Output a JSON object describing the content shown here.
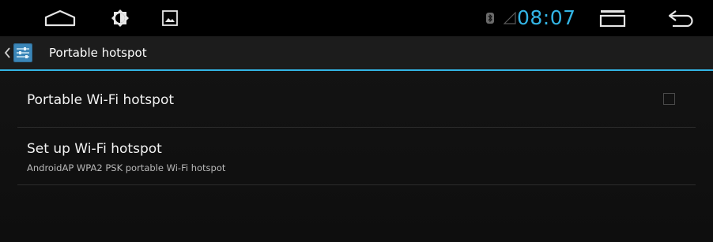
{
  "statusbar": {
    "home_icon": "home-icon",
    "brightness_icon": "brightness-icon",
    "gallery_icon": "gallery-icon",
    "bluetooth_icon": "bluetooth-icon",
    "signal_icon": "signal-icon",
    "time": "08:07",
    "recent_apps_icon": "recent-apps-icon",
    "back_icon": "back-icon",
    "accent_color": "#33b5e5"
  },
  "actionbar": {
    "up_icon": "chevron-left-icon",
    "app_icon": "settings-sliders-icon",
    "title": "Portable hotspot"
  },
  "list": {
    "items": [
      {
        "title": "Portable Wi-Fi hotspot",
        "checked": false
      },
      {
        "title": "Set up Wi-Fi hotspot",
        "summary": "AndroidAP WPA2 PSK portable Wi-Fi hotspot"
      }
    ]
  }
}
